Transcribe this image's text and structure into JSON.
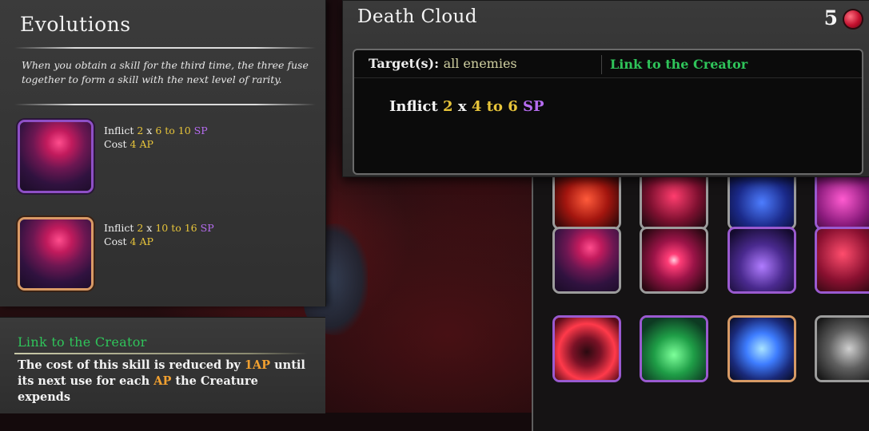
{
  "evolutions": {
    "title": "Evolutions",
    "description": "When you obtain a skill for the third time, the three fuse together to form a skill with the next level of rarity.",
    "tiers": [
      {
        "inflict_label": "Inflict",
        "hits": "2",
        "times": "x",
        "range": "6 to 10",
        "unit": "SP",
        "cost_label": "Cost",
        "cost_value": "4",
        "cost_unit": "AP",
        "frame": "purple"
      },
      {
        "inflict_label": "Inflict",
        "hits": "2",
        "times": "x",
        "range": "10 to 16",
        "unit": "SP",
        "cost_label": "Cost",
        "cost_value": "4",
        "cost_unit": "AP",
        "frame": "gold"
      }
    ]
  },
  "link_panel": {
    "title": "Link to the Creator",
    "text_1": "The cost of this skill is reduced by ",
    "highlight_1": "1AP",
    "text_2": " until its next use for each ",
    "highlight_2": "AP",
    "text_3": " the Creature expends"
  },
  "tooltip": {
    "name": "Death Cloud",
    "cost": "5",
    "cost_icon": "blood-orb-icon",
    "target_label": "Target(s):",
    "target_value": "all enemies",
    "trait": "Link to the Creator",
    "effect": {
      "inflict_label": "Inflict",
      "hits": "2",
      "times": "x",
      "range": "4 to 6",
      "unit": "SP"
    }
  },
  "skill_grid": {
    "tiles": [
      {
        "name": "skill-tile-crimson-orb",
        "frame": "gray"
      },
      {
        "name": "skill-tile-crimson-figure",
        "frame": "gray"
      },
      {
        "name": "skill-tile-blue-shadows",
        "frame": "gray"
      },
      {
        "name": "skill-tile-magenta-orb",
        "frame": "purple"
      },
      {
        "name": "skill-tile-death-cloud",
        "frame": "gray"
      },
      {
        "name": "skill-tile-crimson-slash",
        "frame": "gray"
      },
      {
        "name": "skill-tile-shadow-cultists",
        "frame": "purple"
      },
      {
        "name": "skill-tile-crimson-tentacles",
        "frame": "purple"
      },
      {
        "name": "skill-tile-flame-golem",
        "frame": "purple"
      },
      {
        "name": "skill-tile-green-potion",
        "frame": "purple"
      },
      {
        "name": "skill-tile-blue-lightning",
        "frame": "gold"
      },
      {
        "name": "skill-tile-gray-smoke",
        "frame": "gray"
      }
    ]
  },
  "colors": {
    "damage_value": "#e7c43a",
    "sp_unit": "#b66cf0",
    "trait_green": "#2fc45a",
    "ap_highlight": "#f1a030"
  }
}
